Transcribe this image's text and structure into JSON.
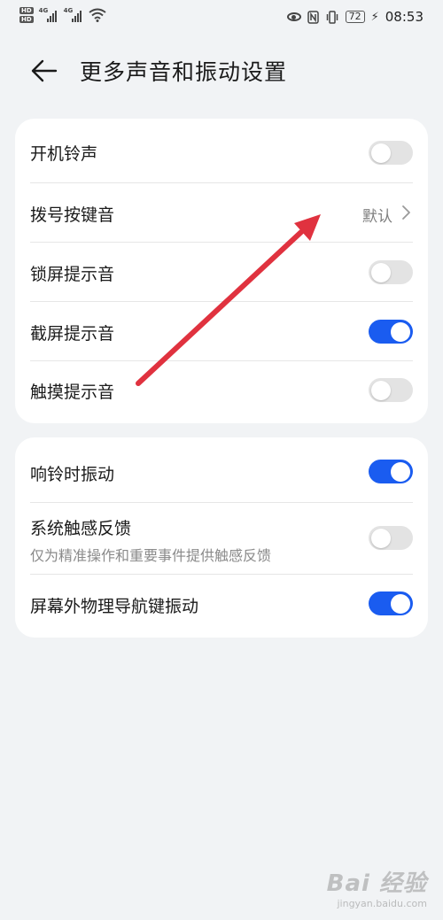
{
  "status_bar": {
    "hd1": "HD",
    "hd2": "HD",
    "net1": "4G",
    "net2": "4G",
    "battery": "72",
    "time": "08:53"
  },
  "header": {
    "title": "更多声音和振动设置"
  },
  "group1": {
    "rows": [
      {
        "label": "开机铃声",
        "toggle_on": false
      },
      {
        "label": "拨号按键音",
        "value": "默认"
      },
      {
        "label": "锁屏提示音",
        "toggle_on": false
      },
      {
        "label": "截屏提示音",
        "toggle_on": true
      },
      {
        "label": "触摸提示音",
        "toggle_on": false
      }
    ]
  },
  "group2": {
    "rows": [
      {
        "label": "响铃时振动",
        "toggle_on": true
      },
      {
        "label": "系统触感反馈",
        "subtitle": "仅为精准操作和重要事件提供触感反馈",
        "toggle_on": false
      },
      {
        "label": "屏幕外物理导航键振动",
        "toggle_on": true
      }
    ]
  },
  "colors": {
    "background": "#f1f3f5",
    "toggle_on": "#1a5cf0",
    "toggle_off": "#e3e3e3",
    "annotation_arrow": "#e0323f"
  },
  "watermark": {
    "main": "Bai 经验",
    "sub": "jingyan.baidu.com"
  }
}
